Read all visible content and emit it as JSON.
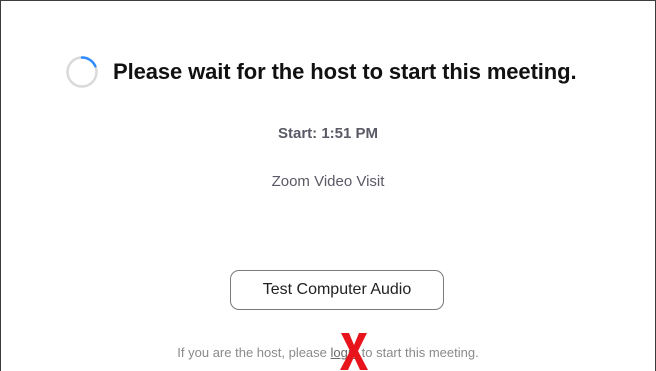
{
  "waiting": {
    "title": "Please wait for the host to start this meeting.",
    "start_time": "Start: 1:51 PM",
    "meeting_name": "Zoom Video Visit"
  },
  "audio": {
    "test_button_label": "Test Computer Audio"
  },
  "host_notice": {
    "prefix": "If you are the host, please",
    "link": "login",
    "suffix": "to start this meeting."
  },
  "colors": {
    "spinner_arc": "#2d8cff",
    "spinner_track": "#d9d9d9",
    "x_mark": "#e8141b"
  },
  "icons": {
    "spinner": "loading-spinner-icon",
    "annotation": "red-x-icon"
  }
}
